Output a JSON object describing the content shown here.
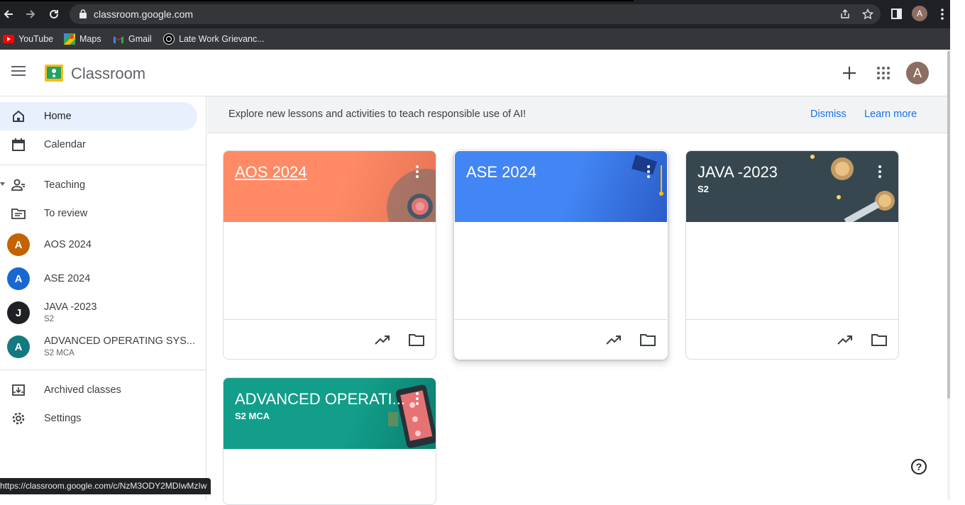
{
  "browser": {
    "url": "classroom.google.com",
    "bookmarks": [
      {
        "label": "YouTube",
        "icon": "youtube-icon"
      },
      {
        "label": "Maps",
        "icon": "maps-icon"
      },
      {
        "label": "Gmail",
        "icon": "gmail-icon"
      },
      {
        "label": "Late Work Grievanc...",
        "icon": "chatgpt-icon"
      }
    ],
    "profile_initial": "A",
    "status_url": "https://classroom.google.com/c/NzM3ODY2MDIwMzIw"
  },
  "app": {
    "title": "Classroom",
    "avatar_initial": "A"
  },
  "sidebar": {
    "home": "Home",
    "calendar": "Calendar",
    "teaching": "Teaching",
    "to_review": "To review",
    "classes": [
      {
        "initial": "A",
        "name": "AOS 2024",
        "sub": "",
        "color": "#c26401"
      },
      {
        "initial": "A",
        "name": "ASE 2024",
        "sub": "",
        "color": "#1967d2"
      },
      {
        "initial": "J",
        "name": "JAVA -2023",
        "sub": "S2",
        "color": "#202124"
      },
      {
        "initial": "A",
        "name": "ADVANCED OPERATING SYS...",
        "sub": "S2 MCA",
        "color": "#137a7f"
      }
    ],
    "archived": "Archived classes",
    "settings": "Settings"
  },
  "banner": {
    "text": "Explore new lessons and activities to teach responsible use of AI!",
    "dismiss": "Dismiss",
    "learn_more": "Learn more"
  },
  "cards": [
    {
      "title": "AOS 2024",
      "sub": "",
      "color": "#ff8a65"
    },
    {
      "title": "ASE 2024",
      "sub": "",
      "color": "#4285f4"
    },
    {
      "title": "JAVA -2023",
      "sub": "S2",
      "color": "#37474f"
    },
    {
      "title": "ADVANCED OPERATI...",
      "sub": "S2 MCA",
      "color": "#129e8a"
    }
  ]
}
